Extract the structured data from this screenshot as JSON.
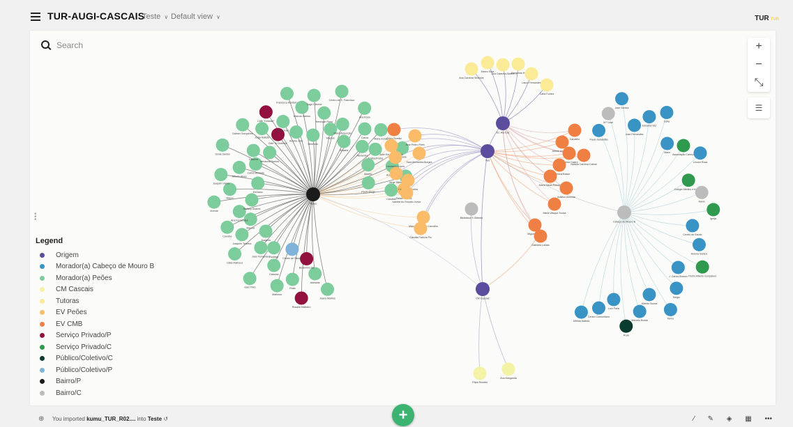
{
  "header": {
    "title": "TUR-AUGI-CASCAIS",
    "crumbs": [
      "Teste",
      "Default view"
    ],
    "brand": "TUR",
    "brand_sub": "TUR"
  },
  "search": {
    "placeholder": "Search"
  },
  "zoom": {
    "in": "+",
    "out": "−",
    "fit": "⤡"
  },
  "legend": {
    "title": "Legend",
    "items": [
      {
        "label": "Origem",
        "color": "#5b4c9e"
      },
      {
        "label": "Morador(a) Cabeço de Mouro B",
        "color": "#3a93c5"
      },
      {
        "label": "Morador(a) Peões",
        "color": "#7ccc9c"
      },
      {
        "label": "CM Cascais",
        "color": "#f3f3a6"
      },
      {
        "label": "Tutoras",
        "color": "#fbeb96"
      },
      {
        "label": "EV Peões",
        "color": "#fbbc6a"
      },
      {
        "label": "EV CMB",
        "color": "#f07f44"
      },
      {
        "label": "Serviço Privado/P",
        "color": "#93113f"
      },
      {
        "label": "Serviço Privado/C",
        "color": "#2f9a4d"
      },
      {
        "label": "Público/Coletivo/C",
        "color": "#093b2e"
      },
      {
        "label": "Público/Coletivo/P",
        "color": "#7fb3d9"
      },
      {
        "label": "Bairro/P",
        "color": "#1b1b1b"
      },
      {
        "label": "Bairro/C",
        "color": "#bcbcbc"
      }
    ]
  },
  "graph": {
    "bairro_p": "Peões",
    "bairro_c": "Cabeço de Mouro B",
    "cm_cascais": "CM Cascais",
    "biblioteca": "Biblioteca S.Gilberto",
    "hubs": [
      "Ex. Aia Cas",
      "Taís"
    ],
    "pe_labels": [
      "Joana Martins",
      "Adelaide",
      "Belarmino Sá",
      "Rosalia Malheiro",
      "Rosa",
      "Centro de Saúde",
      "Matheus",
      "Catarina",
      "Rodrigo",
      "José Pinto",
      "José Fernandes",
      "Joaquim",
      "Cátia Matheus",
      "Joaquim Teixeira",
      "Manuel",
      "Caroline",
      "Ana Fernandes",
      "Stefany Soares",
      "Vicente",
      "Mauro",
      "Emiliano",
      "Joaquim Vieira",
      "Alfredo Alves",
      "Carlos Almeida",
      "Sónia Santos",
      "Catalina",
      "Venância Santos",
      "Gabriel Gonçalves",
      "Jorge Batista",
      "Café \"A Chaleira\"",
      "Café \"Girassol\"",
      "Maria Foto",
      "Amélia José",
      "Francisca Monteiro",
      "Marcos Santos",
      "Hermínio",
      "Tiago Oliveira",
      "Henrique Rosa",
      "Marcos",
      "Centro de S. Francisco",
      "Maria Assunção",
      "Rosaria",
      "Ana Rosa",
      "Carlos",
      "Alexandre",
      "Maria Zonas",
      "Amélia Frotas",
      "Alberto",
      "Ismaria",
      "Ana Diogo",
      "Paulo Diogo",
      "Gesualdo",
      "Cândido"
    ],
    "ev_labels": [
      "Olivia Romão",
      "José Eduardo Cunha",
      "Leonardo Lopes",
      "Jorge Milena",
      "Rafael Gomes",
      "José Pedro Pires",
      "Sara Alexandra Borges",
      "Claudete Teixeira",
      "Ivanete do Rosário Junior",
      "Manuela Iúlio do Carvalho",
      "Cláudia Patrícia Pio"
    ],
    "cmb_ev_labels": [
      "Carvalho",
      "Arlene Ana Neves",
      "Catarina Castro",
      "Natalia Carolina Cabral",
      "Guilhermina Basso",
      "Albert Salas Ferreira",
      "Adalino Almeida",
      "Maria Vasque Sousa",
      "Miguel Lopes",
      "Gabriela Lobato"
    ],
    "tut_labels": [
      "Ana Carolina Silvestre",
      "Marco Silva",
      "Ana Catarina Albano",
      "Margarida H.",
      "Laura Fernandes",
      "Carla Fontes"
    ],
    "cm_labels": [
      "Filipa Rosado",
      "Ana Margarida"
    ],
    "cm_labels_top": [],
    "cb_labels": [
      "Paulo Sebastião",
      "M.ª José",
      "José Santos",
      "José Fernandes",
      "Eduarda Vaz",
      "Célia",
      "Mário",
      "Associação Cabeço",
      "Leonor Rosa",
      "Colégio Médico e Infância",
      "Mario",
      "Igreja",
      "Centro de Saúde",
      "Helena Santos",
      "Pedro Alberto Gonçalves",
      "J. Carlos Branco",
      "Sérgio",
      "Telmo",
      "Alberto Sousa",
      "Marcelo Bocas",
      "Ruía",
      "Luís Faria",
      "Centro Comunitário",
      "Alfredo Batista"
    ]
  },
  "footer": {
    "status_prefix": "You imported",
    "status_file": "kumu_TUR_R02....",
    "status_mid": "into",
    "status_target": "Teste"
  }
}
